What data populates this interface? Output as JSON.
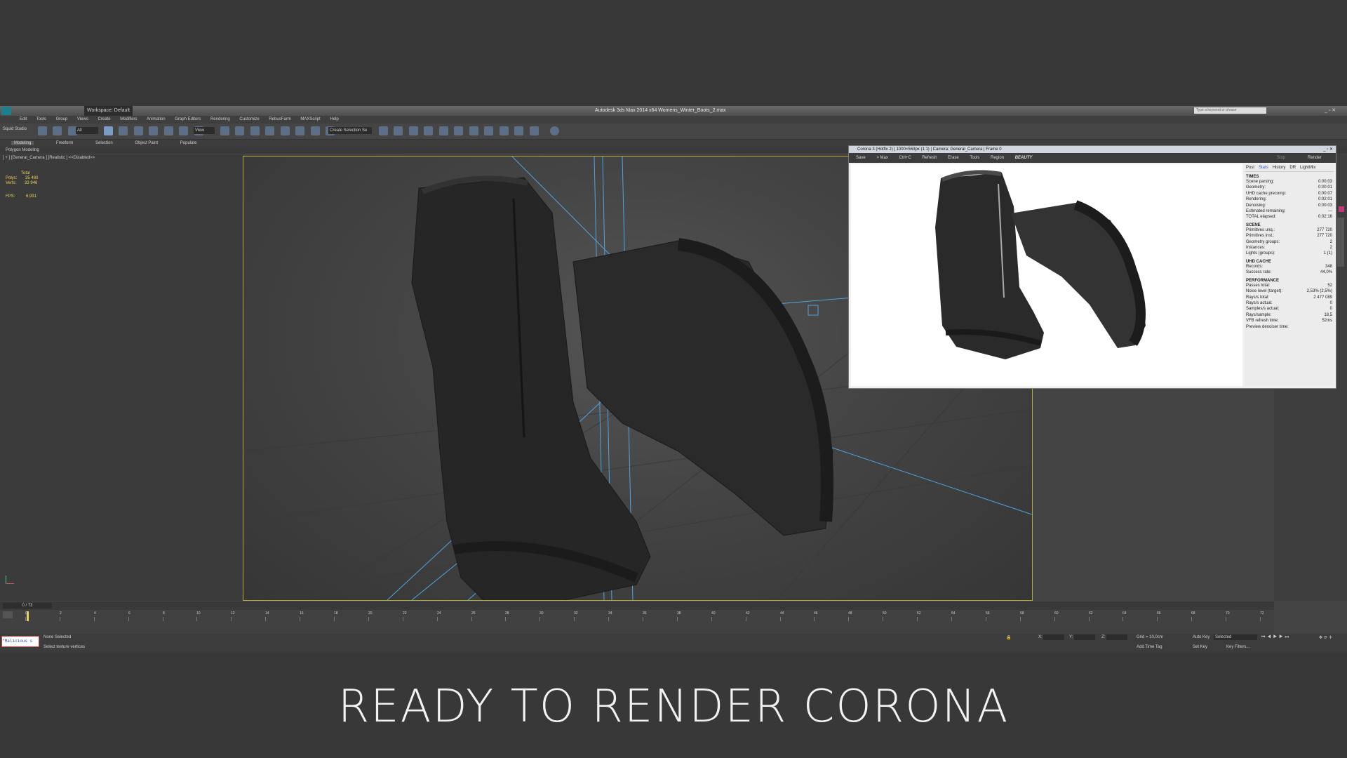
{
  "app": {
    "title": "Autodesk 3ds Max 2014 x64     Womens_Winter_Boots_2.max",
    "workspace": "Workspace: Default",
    "search_placeholder": "Type a keyword or phrase"
  },
  "menu": [
    "Edit",
    "Tools",
    "Group",
    "Views",
    "Create",
    "Modifiers",
    "Animation",
    "Graph Editors",
    "Rendering",
    "Customize",
    "RebusFarm",
    "MAXScript",
    "Help"
  ],
  "toolbar": {
    "studio_label": "Squid Studio",
    "filter_value": "All",
    "view_value": "View",
    "selection_set": "Create Selection Se"
  },
  "ribbon": {
    "tabs": [
      "Modeling",
      "Freeform",
      "Selection",
      "Object Paint",
      "Populate"
    ],
    "sub_label": "Polygon Modeling"
  },
  "viewport": {
    "label": "[ + ] [General_Camera ] [Realistic ] <<Disabled>>",
    "stats": {
      "total_label": "Total",
      "polys_label": "Polys:",
      "polys": "35 480",
      "verts_label": "Verts:",
      "verts": "33 946",
      "fps_label": "FPS:",
      "fps": "6,931"
    }
  },
  "timeline": {
    "frame_counter": "0 / 73",
    "ticks": [
      "0",
      "2",
      "4",
      "6",
      "8",
      "10",
      "12",
      "14",
      "16",
      "18",
      "20",
      "22",
      "24",
      "26",
      "28",
      "30",
      "32",
      "34",
      "36",
      "38",
      "40",
      "42",
      "44",
      "46",
      "48",
      "50",
      "52",
      "54",
      "56",
      "58",
      "60",
      "62",
      "64",
      "66",
      "68",
      "70",
      "72"
    ]
  },
  "status": {
    "maxscript": "\"Malicious s",
    "selection": "None Selected",
    "prompt": "Select texture vertices",
    "grid": "Grid = 10,0cm",
    "add_time_tag": "Add Time Tag",
    "auto_key": "Auto Key",
    "set_key": "Set Key",
    "key_mode_value": "Selected",
    "key_filters": "Key Filters...",
    "x_label": "X:",
    "y_label": "Y:",
    "z_label": "Z:"
  },
  "corona": {
    "title": "Corona 3 (Hotfix 2) | 1000×563px (1:1) | Camera: General_Camera | Frame 0",
    "tools": [
      "Save",
      "> Max",
      "Ctrl+C",
      "Refresh",
      "Erase",
      "Tools",
      "Region"
    ],
    "pass": "BEAUTY",
    "stop": "Stop",
    "render": "Render",
    "tabs": [
      "Post",
      "Stats",
      "History",
      "DR",
      "LightMix"
    ],
    "sections": [
      {
        "head": "TIMES",
        "rows": [
          [
            "Scene parsing:",
            "0:00:03"
          ],
          [
            "Geometry:",
            "0:00:01"
          ],
          [
            "UHD cache precomp:",
            "0:00:07"
          ],
          [
            "Rendering:",
            "0:02:01"
          ],
          [
            "Denoising:",
            "0:00:03"
          ],
          [
            "Estimated remaining:",
            "---"
          ],
          [
            "TOTAL elapsed:",
            "0:02:16"
          ]
        ]
      },
      {
        "head": "SCENE",
        "rows": [
          [
            "Primitives unq.:",
            "277 720"
          ],
          [
            "Primitives inst.:",
            "277 720"
          ],
          [
            "Geometry groups:",
            "2"
          ],
          [
            "Instances:",
            "2"
          ],
          [
            "Lights (groups):",
            "1 (1)"
          ]
        ]
      },
      {
        "head": "UHD CACHE",
        "rows": [
          [
            "Records:",
            "348"
          ],
          [
            "Success rate:",
            "44,0%"
          ]
        ]
      },
      {
        "head": "PERFORMANCE",
        "rows": [
          [
            "Passes total:",
            "52"
          ],
          [
            "Noise level (target):",
            "2,53% (2,5%)"
          ],
          [
            "Rays/s total:",
            "2 477 089"
          ],
          [
            "Rays/s actual:",
            "0"
          ],
          [
            "Samples/s actual:",
            "0"
          ],
          [
            "Rays/sample:",
            "18,5"
          ],
          [
            "VFB refresh time:",
            "52ms"
          ],
          [
            "Preview denoiser time:",
            ""
          ]
        ]
      }
    ]
  },
  "caption": "READY TO RENDER  CORONA",
  "colors": {
    "viewport_border": "#b4ac3a",
    "camera_lines": "#4fa3e0",
    "app_bg": "#444444"
  }
}
